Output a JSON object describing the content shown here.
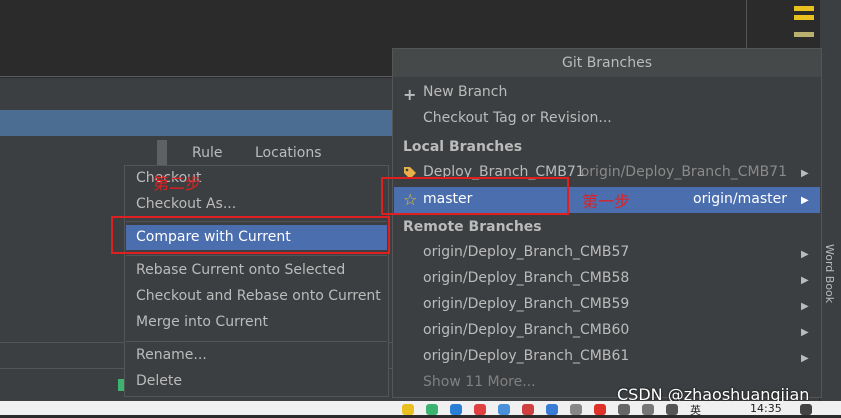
{
  "background": {
    "columns": {
      "rule": "Rule",
      "locations": "Locations"
    },
    "side_tool": "Word Book"
  },
  "context_menu": {
    "items": [
      {
        "label": "Checkout"
      },
      {
        "label": "Checkout As..."
      },
      {
        "label": "Compare with Current",
        "selected": true
      },
      {
        "label": "Rebase Current onto Selected"
      },
      {
        "label": "Checkout and Rebase onto Current"
      },
      {
        "label": "Merge into Current"
      },
      {
        "label": "Rename..."
      },
      {
        "label": "Delete"
      }
    ]
  },
  "git_branches": {
    "title": "Git Branches",
    "actions": [
      {
        "label": "New Branch",
        "icon": "plus-icon"
      },
      {
        "label": "Checkout Tag or Revision..."
      }
    ],
    "local_header": "Local Branches",
    "local": [
      {
        "label": "Deploy_Branch_CMB71",
        "tracking": "origin/Deploy_Branch_CMB71",
        "icon": "tag-icon"
      },
      {
        "label": "master",
        "tracking": "origin/master",
        "icon": "star-icon",
        "selected": true
      }
    ],
    "remote_header": "Remote Branches",
    "remote": [
      {
        "label": "origin/Deploy_Branch_CMB57"
      },
      {
        "label": "origin/Deploy_Branch_CMB58"
      },
      {
        "label": "origin/Deploy_Branch_CMB59"
      },
      {
        "label": "origin/Deploy_Branch_CMB60"
      },
      {
        "label": "origin/Deploy_Branch_CMB61"
      }
    ],
    "show_more": "Show 11 More..."
  },
  "annotations": {
    "step1": "第一步",
    "step2": "第二步"
  },
  "watermark": "CSDN @zhaoshuangjian",
  "taskbar": {
    "time": "14:35",
    "ime": "英"
  },
  "colors": {
    "selection": "#4b6eaf",
    "annotation": "#e02020",
    "panel": "#3c3f41"
  }
}
